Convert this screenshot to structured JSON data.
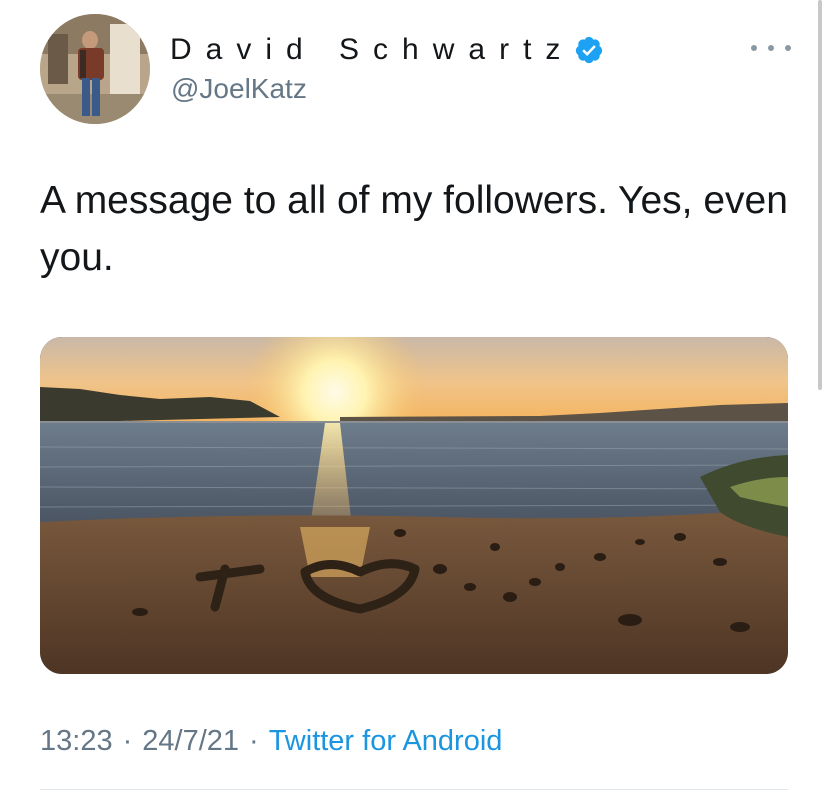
{
  "tweet": {
    "author": {
      "display_name": "David Schwartz",
      "handle": "@JoelKatz",
      "verified": true,
      "avatar_icon": "profile-photo"
    },
    "text": "A message to all of my followers. Yes, even you.",
    "media": {
      "type": "photo",
      "alt_icon": "sunset-beach-heart-photo"
    },
    "time": "13:23",
    "date": "24/7/21",
    "separator": "·",
    "source": "Twitter for Android",
    "more_icon": "more-options-icon"
  },
  "colors": {
    "text": "#14171a",
    "secondary": "#657786",
    "link": "#1b95e0",
    "verified": "#1da1f2",
    "divider": "#e1e8ed"
  }
}
